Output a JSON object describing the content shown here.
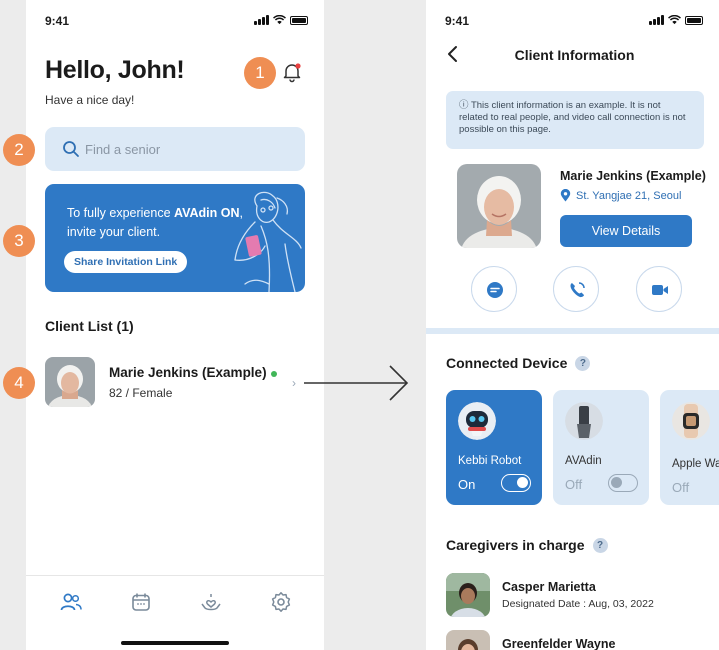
{
  "left_screen": {
    "status_time": "9:41",
    "greeting": "Hello, John!",
    "subgreeting": "Have a nice day!",
    "search": {
      "placeholder": "Find a senior"
    },
    "banner": {
      "line1_prefix": "To fully experience ",
      "line1_brand": "AVAdin ON",
      "line1_suffix": ",",
      "line2": "invite your client.",
      "share_button": "Share Invitation Link"
    },
    "client_list_title": "Client List (1)",
    "clients": [
      {
        "name": "Marie Jenkins (Example)",
        "meta": "82 / Female",
        "online": true
      }
    ],
    "tabs": [
      "people-icon",
      "calendar-icon",
      "care-icon",
      "settings-icon"
    ]
  },
  "markers": [
    "1",
    "2",
    "3",
    "4"
  ],
  "right_screen": {
    "status_time": "9:41",
    "title": "Client Information",
    "notice": "ⓘ This client information is an example. It is not related to real people, and video call connection is not possible on this page.",
    "client": {
      "name": "Marie Jenkins (Example)",
      "location": "St. Yangjae 21, Seoul",
      "view_details": "View Details"
    },
    "actions": [
      "chat-icon",
      "phone-icon",
      "video-icon"
    ],
    "connected_device_title": "Connected Device",
    "help_mark": "?",
    "devices": [
      {
        "name": "Kebbi Robot",
        "state": "On",
        "on": true
      },
      {
        "name": "AVAdin",
        "state": "Off",
        "on": false
      },
      {
        "name": "Apple Wa",
        "state": "Off",
        "on": false
      }
    ],
    "caregivers_title": "Caregivers in charge",
    "caregivers": [
      {
        "name": "Casper Marietta",
        "date": "Designated Date : Aug, 03, 2022"
      },
      {
        "name": "Greenfelder Wayne",
        "date": ""
      }
    ]
  },
  "colors": {
    "accent": "#2f79c6",
    "light_accent": "#dce9f6",
    "marker": "#ef8e53",
    "online": "#41b658"
  }
}
